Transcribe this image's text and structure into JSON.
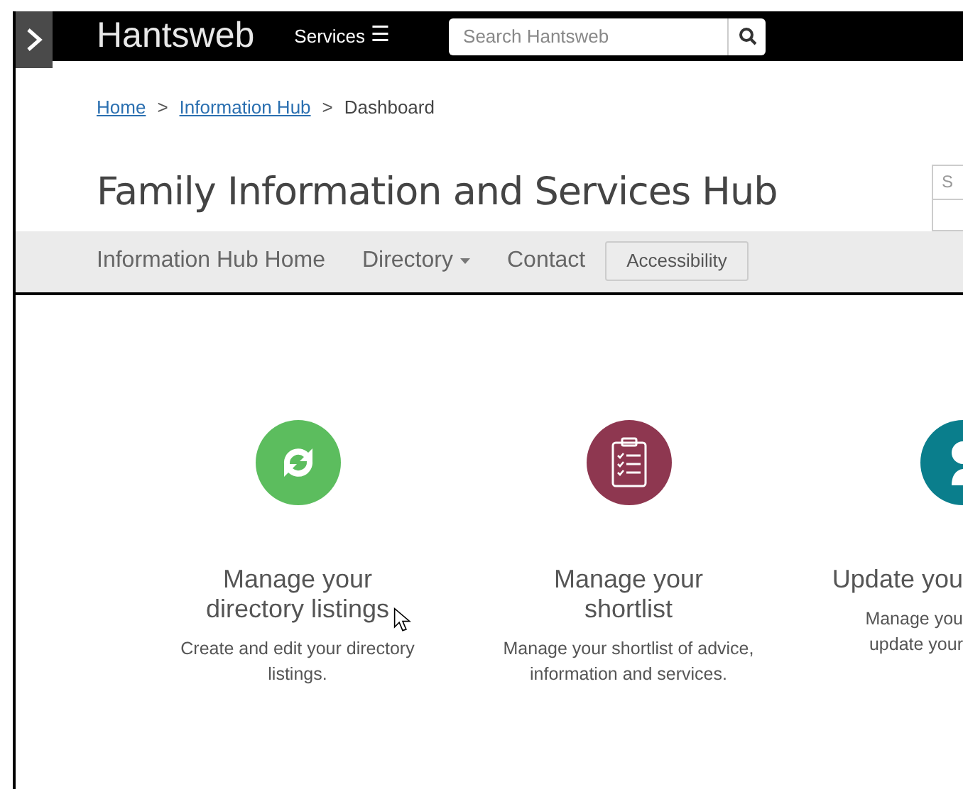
{
  "header": {
    "logo": "Hantsweb",
    "services": "Services",
    "menu_glyph": "☰",
    "search": {
      "placeholder": "Search Hantsweb"
    }
  },
  "breadcrumb": [
    {
      "label": "Home",
      "kind": "link"
    },
    {
      "label": "Information Hub",
      "kind": "link"
    },
    {
      "label": "Dashboard",
      "kind": "current"
    }
  ],
  "breadcrumb_separator": ">",
  "title": "Family Information and Services Hub",
  "side_search": {
    "placeholder": "S"
  },
  "nav": [
    {
      "label": "Information Hub Home",
      "kind": "link"
    },
    {
      "label": "Directory",
      "kind": "dropdown"
    },
    {
      "label": "Contact",
      "kind": "link"
    },
    {
      "label": "Accessibility",
      "kind": "button"
    }
  ],
  "cards": [
    {
      "kind": "sync",
      "color": "#5cbd5e",
      "title": "Manage your directory listings",
      "description": "Create and edit your directory listings."
    },
    {
      "kind": "clipboard",
      "color": "#8e3750",
      "title": "Manage your shortlist",
      "description": "Manage your shortlist of advice, information and services."
    },
    {
      "kind": "person",
      "color": "#0a7e8c",
      "title": "Update you",
      "description": "Manage you update your"
    }
  ]
}
